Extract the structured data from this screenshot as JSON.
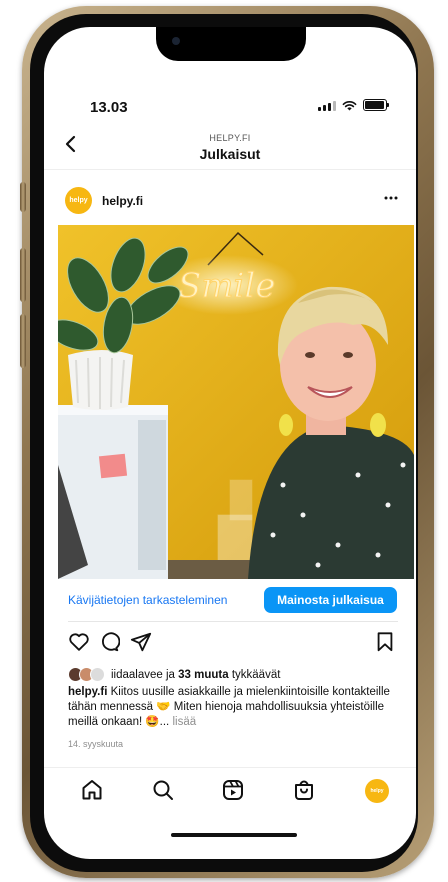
{
  "status_bar": {
    "time": "13.03",
    "signal_icon": "signal-bars-icon",
    "wifi_icon": "wifi-icon",
    "battery_icon": "battery-icon"
  },
  "header": {
    "back_icon": "chevron-left-icon",
    "subtitle": "HELPY.FI",
    "title": "Julkaisut"
  },
  "post": {
    "avatar_text": "helpy",
    "username": "helpy.fi",
    "more_icon": "ellipsis-icon",
    "image": {
      "neon_text": "Smile",
      "colors": {
        "wall": "#e3ae12",
        "neon": "#fff3c4",
        "shirt": "#2b3a33"
      }
    },
    "cta": {
      "insights_link": "Kävijätietojen tarkasteleminen",
      "promote_button": "Mainosta julkaisua"
    },
    "actions": [
      "heart-icon",
      "comment-icon",
      "share-icon",
      "bookmark-icon"
    ],
    "likes": {
      "liked_by": "iidaalavee",
      "connector": " ja ",
      "others": "33 muuta",
      "suffix": " tykkäävät"
    },
    "caption": {
      "username": "helpy.fi",
      "text": "Kiitos uusille asiakkaille ja mielenkiintoisille kontakteille tähän mennessä 🤝 Miten hienoja mahdollisuuksia yhteistöille meillä onkaan! 🤩",
      "ellipsis": "... ",
      "more": "lisää"
    },
    "date": "14. syyskuuta"
  },
  "bottom_nav": {
    "items": [
      "home-icon",
      "search-icon",
      "reels-icon",
      "shop-icon"
    ],
    "profile_avatar_text": "helpy"
  },
  "colors": {
    "accent_blue": "#0a95f6",
    "link_blue": "#1877f2",
    "brand_yellow": "#f7b712",
    "phone_gold": "#8f7650"
  }
}
